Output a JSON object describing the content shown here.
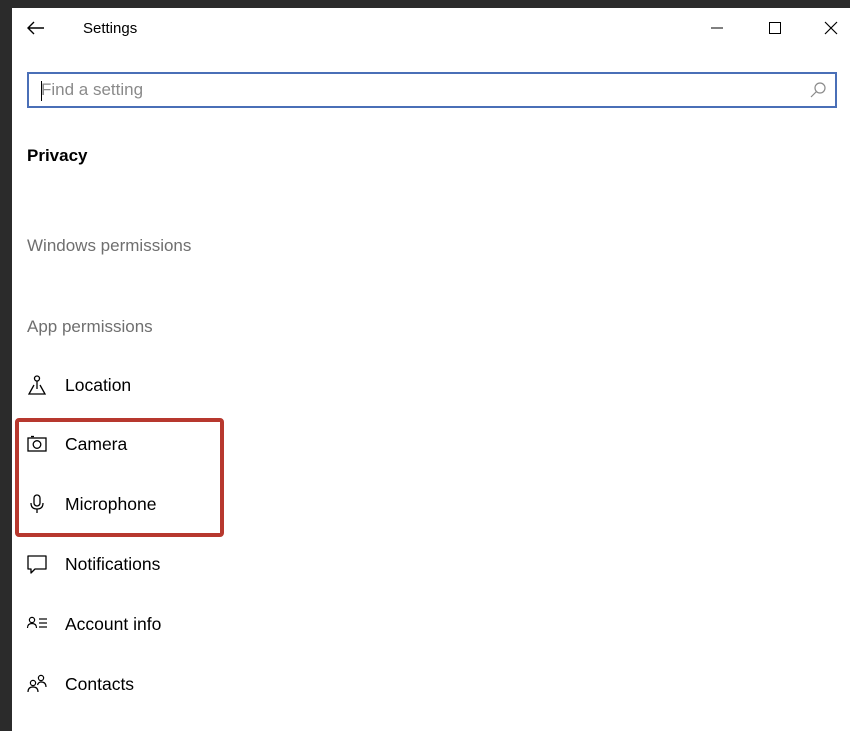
{
  "window": {
    "title": "Settings",
    "controls": {
      "minimize_glyph": "—",
      "maximize_glyph": "☐",
      "close_glyph": "✕"
    }
  },
  "search": {
    "placeholder": "Find a setting",
    "value": "",
    "icon": "search-icon"
  },
  "page": {
    "title": "Privacy"
  },
  "sections": {
    "windows_permissions": "Windows permissions",
    "app_permissions": "App permissions"
  },
  "nav_items": [
    {
      "label": "Location",
      "icon": "location-icon"
    },
    {
      "label": "Camera",
      "icon": "camera-icon"
    },
    {
      "label": "Microphone",
      "icon": "microphone-icon"
    },
    {
      "label": "Notifications",
      "icon": "notifications-icon"
    },
    {
      "label": "Account info",
      "icon": "account-info-icon"
    },
    {
      "label": "Contacts",
      "icon": "contacts-icon"
    }
  ],
  "annotation": {
    "highlight_color": "#b7382e",
    "highlighted_items": [
      "Camera",
      "Microphone"
    ]
  },
  "colors": {
    "search_border": "#4a6fb7",
    "section_header": "#6f6f6f",
    "background": "#ffffff"
  }
}
